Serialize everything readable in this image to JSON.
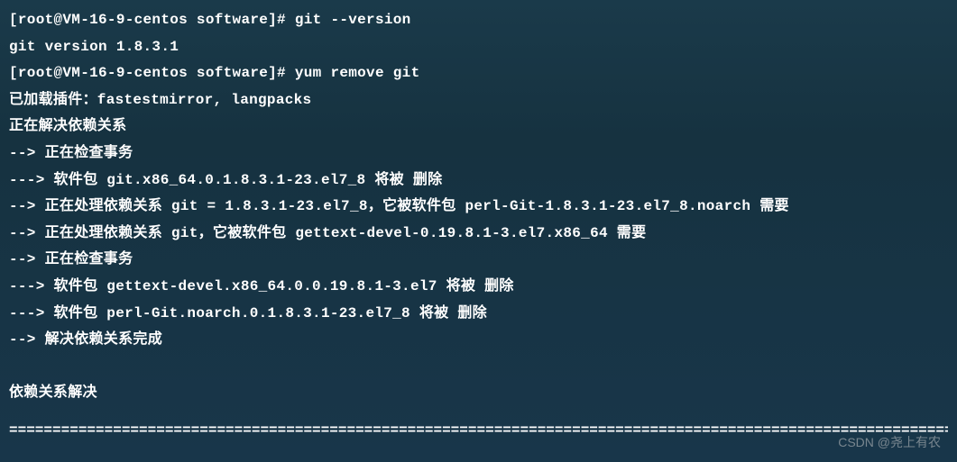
{
  "lines": {
    "prompt1": "[root@VM-16-9-centos software]# git --version",
    "out1": "git version 1.8.3.1",
    "prompt2": "[root@VM-16-9-centos software]# yum remove git",
    "out2": "已加载插件：fastestmirror, langpacks",
    "out3": "正在解决依赖关系",
    "out4": "--> 正在检查事务",
    "out5": "---> 软件包 git.x86_64.0.1.8.3.1-23.el7_8 将被 删除",
    "out6": "--> 正在处理依赖关系 git = 1.8.3.1-23.el7_8，它被软件包 perl-Git-1.8.3.1-23.el7_8.noarch 需要",
    "out7": "--> 正在处理依赖关系 git，它被软件包 gettext-devel-0.19.8.1-3.el7.x86_64 需要",
    "out8": "--> 正在检查事务",
    "out9": "---> 软件包 gettext-devel.x86_64.0.0.19.8.1-3.el7 将被 删除",
    "out10": "---> 软件包 perl-Git.noarch.0.1.8.3.1-23.el7_8 将被 删除",
    "out11": "--> 解决依赖关系完成",
    "out12": "依赖关系解决"
  },
  "divider": "====================================================================================================================================",
  "watermark": "CSDN @尧上有农"
}
